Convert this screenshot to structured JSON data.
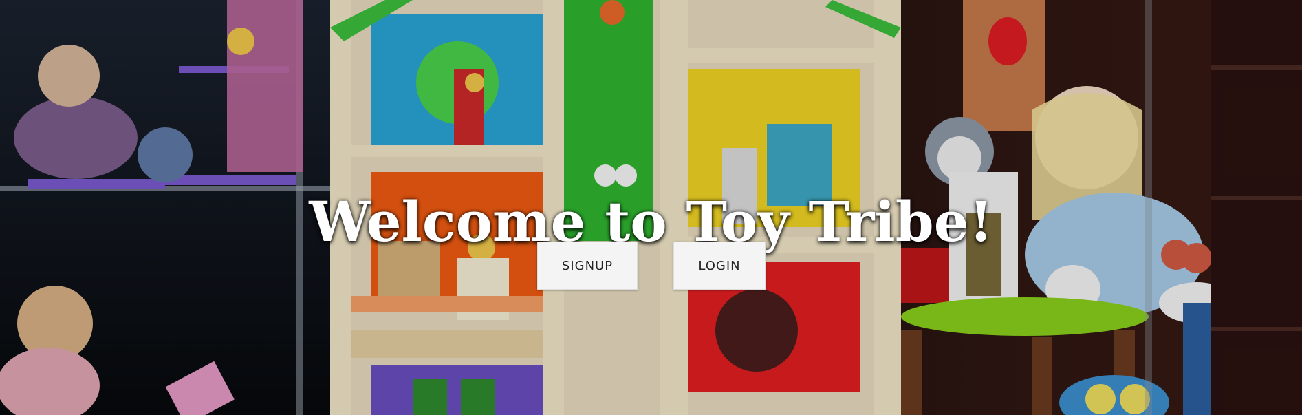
{
  "hero": {
    "title": "Welcome to Toy Tribe!",
    "background_image": "toy-shop-window-dollhouse",
    "colors": {
      "title": "#ffffff",
      "button_bg": "#f4f4f4",
      "button_text": "#222222"
    }
  },
  "actions": {
    "signup_label": "SIGNUP",
    "login_label": "LOGIN"
  }
}
